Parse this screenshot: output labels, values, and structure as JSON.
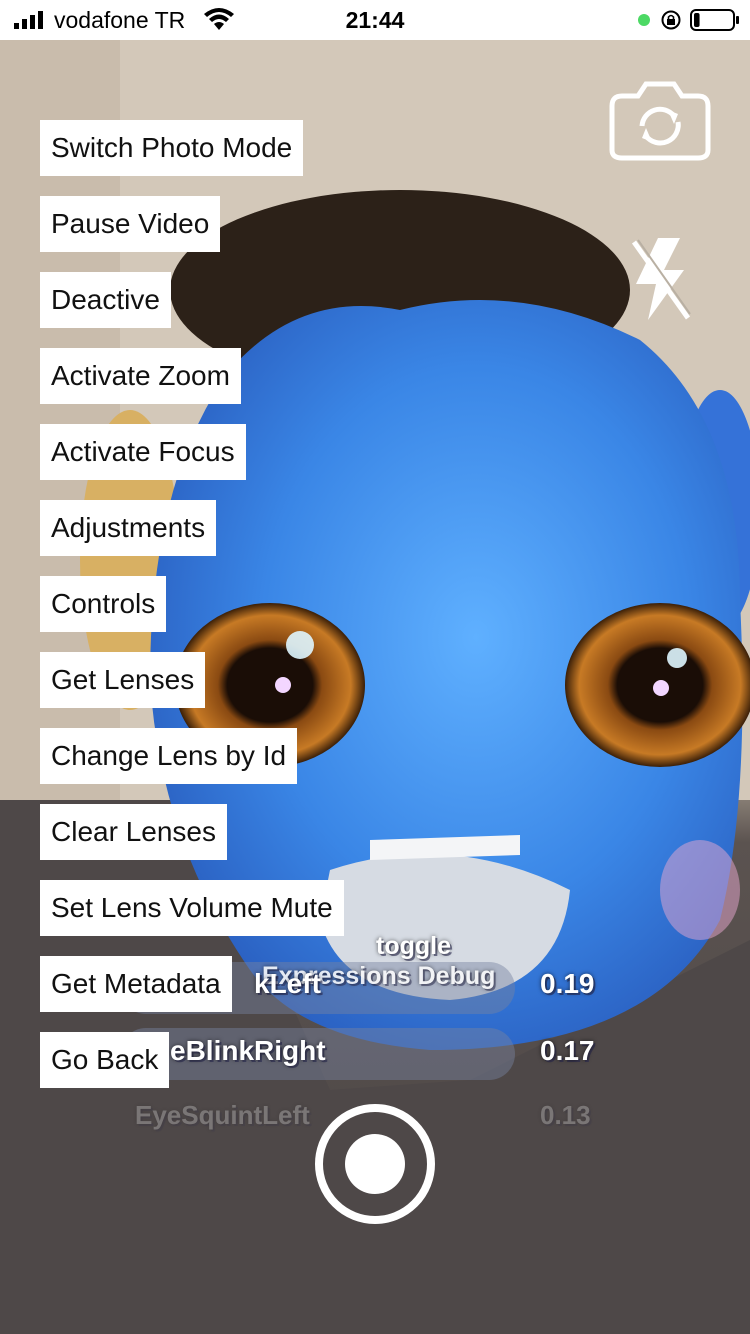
{
  "status_bar": {
    "carrier": "vodafone TR",
    "time": "21:44",
    "icons": [
      "signal-bars-icon",
      "wifi-icon",
      "green-dot-indicator",
      "rotation-lock-icon",
      "battery-icon"
    ],
    "battery_level": 0.15
  },
  "camera_controls": {
    "switch_camera_icon": "camera-switch-icon",
    "flash_icon": "flash-off-icon"
  },
  "menu": {
    "items": [
      {
        "label": "Switch Photo Mode"
      },
      {
        "label": "Pause Video"
      },
      {
        "label": "Deactive"
      },
      {
        "label": "Activate Zoom"
      },
      {
        "label": "Activate Focus"
      },
      {
        "label": "Adjustments"
      },
      {
        "label": "Controls"
      },
      {
        "label": "Get Lenses"
      },
      {
        "label": "Change Lens by Id"
      },
      {
        "label": "Clear Lenses"
      },
      {
        "label": "Set Lens Volume Mute"
      },
      {
        "label": "Get Metadata"
      },
      {
        "label": "Go Back"
      }
    ]
  },
  "debug_overlay": {
    "toggle_text": "toggle",
    "title": "Expressions Debug",
    "rows": [
      {
        "label": "kLeft",
        "value": "0.19"
      },
      {
        "label": "eBlinkRight",
        "value": "0.17"
      },
      {
        "label": "EyeSquintLeft",
        "value": "0.13"
      }
    ]
  },
  "shutter": {
    "icon": "shutter-record-icon"
  },
  "colors": {
    "menu_background": "#ffffff",
    "face_blue": "#3f8fea",
    "status_green": "#4cd964"
  }
}
